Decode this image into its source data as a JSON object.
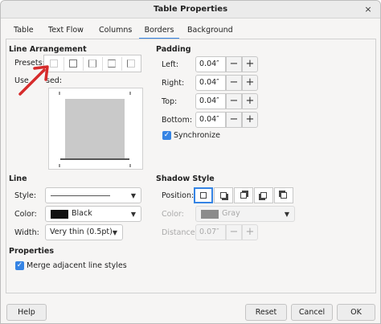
{
  "window": {
    "title": "Table Properties"
  },
  "tabs": [
    {
      "label": "Table"
    },
    {
      "label": "Text Flow"
    },
    {
      "label": "Columns"
    },
    {
      "label": "Borders",
      "active": true
    },
    {
      "label": "Background"
    }
  ],
  "line_arrangement": {
    "heading": "Line Arrangement",
    "presets_label": "Presets:",
    "user_defined_label": "Use",
    "user_defined_label_tail": "sed:"
  },
  "padding": {
    "heading": "Padding",
    "left_label": "Left:",
    "left_value": "0.04″",
    "right_label": "Right:",
    "right_value": "0.04″",
    "top_label": "Top:",
    "top_value": "0.04″",
    "bottom_label": "Bottom:",
    "bottom_value": "0.04″",
    "synchronize_label": "Synchronize",
    "synchronize_checked": true
  },
  "line": {
    "heading": "Line",
    "style_label": "Style:",
    "color_label": "Color:",
    "color_value": "Black",
    "color_hex": "#111111",
    "width_label": "Width:",
    "width_value": "Very thin (0.5pt)"
  },
  "shadow": {
    "heading": "Shadow Style",
    "position_label": "Position:",
    "color_label": "Color:",
    "color_value": "Gray",
    "color_hex": "#8c8c8c",
    "distance_label": "Distance:",
    "distance_value": "0.07″"
  },
  "properties": {
    "heading": "Properties",
    "merge_label": "Merge adjacent line styles",
    "merge_checked": true
  },
  "buttons": {
    "help": "Help",
    "reset": "Reset",
    "cancel": "Cancel",
    "ok": "OK"
  },
  "icons": {
    "close": "×",
    "plus": "+",
    "minus": "−",
    "caret": "▼",
    "check": "✓"
  },
  "colors": {
    "accent": "#3584e4",
    "annotation_arrow": "#d62b2b"
  }
}
